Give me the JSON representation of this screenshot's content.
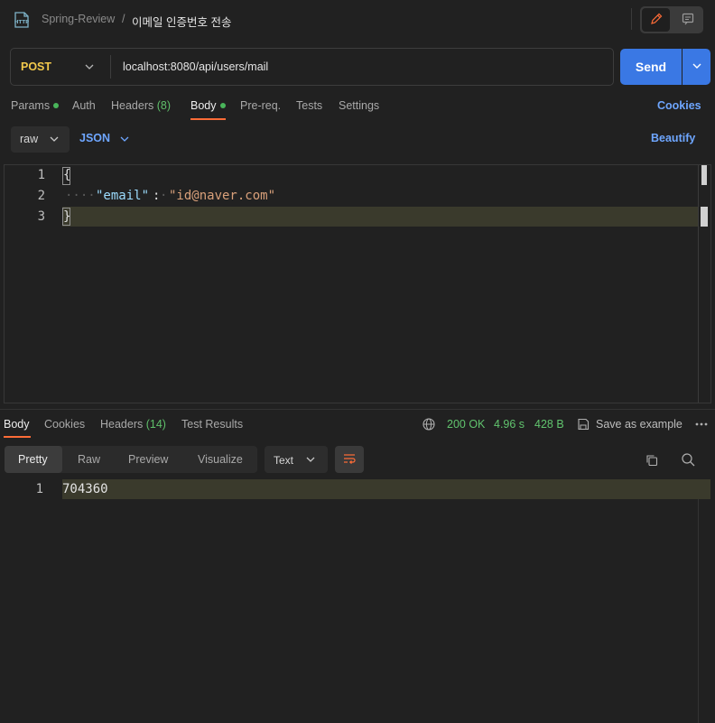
{
  "header": {
    "collection": "Spring-Review",
    "separator": "/",
    "request_name": "이메일 인증번호 전송",
    "app_icon": "http-file-icon",
    "edit_icon": "pencil-icon",
    "comment_icon": "comment-icon"
  },
  "request": {
    "method": "POST",
    "url": "localhost:8080/api/users/mail",
    "send_label": "Send"
  },
  "request_tabs": [
    {
      "label": "Params",
      "dot": true
    },
    {
      "label": "Auth"
    },
    {
      "label": "Headers",
      "count": "(8)"
    },
    {
      "label": "Body",
      "dot": true,
      "active": true
    },
    {
      "label": "Pre-req."
    },
    {
      "label": "Tests"
    },
    {
      "label": "Settings"
    }
  ],
  "cookies_label": "Cookies",
  "body_options": {
    "mode": "raw",
    "language": "JSON",
    "beautify_label": "Beautify"
  },
  "request_editor": {
    "line_numbers": [
      "1",
      "2",
      "3"
    ],
    "line1": "{",
    "indent_dots": "····",
    "key": "\"email\"",
    "colon": ":",
    "space_dot": "·",
    "value": "\"id@naver.com\"",
    "line3": "}"
  },
  "response_tabs": [
    {
      "label": "Body",
      "active": true
    },
    {
      "label": "Cookies"
    },
    {
      "label": "Headers",
      "count": "(14)"
    },
    {
      "label": "Test Results"
    }
  ],
  "response_status": {
    "status": "200 OK",
    "time": "4.96 s",
    "size": "428 B",
    "save_label": "Save as example"
  },
  "view_tabs": [
    "Pretty",
    "Raw",
    "Preview",
    "Visualize"
  ],
  "format": "Text",
  "response_body": {
    "line_number": "1",
    "content": "704360"
  },
  "colors": {
    "accent": "#ff6c37",
    "send": "#3a78e4",
    "link": "#6ea6ff",
    "method": "#f2c94c",
    "success": "#61c46e"
  }
}
